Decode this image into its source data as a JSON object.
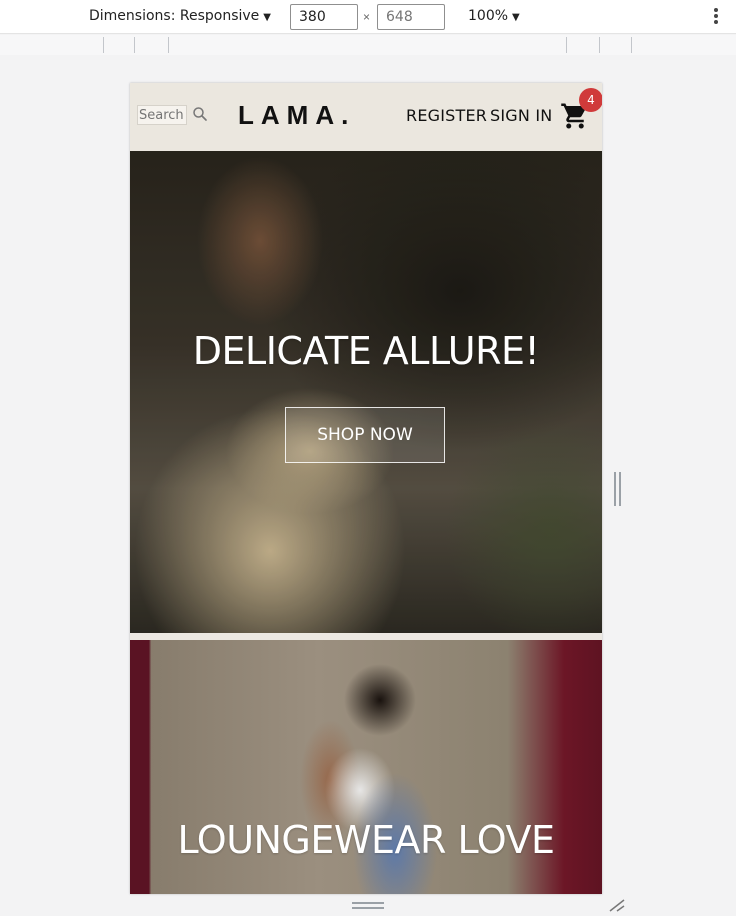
{
  "devtools": {
    "dimensions_label": "Dimensions: Responsive",
    "width_value": "380",
    "height_placeholder": "648",
    "times": "×",
    "zoom_label": "100%",
    "caret": "▼"
  },
  "site": {
    "search_placeholder": "Search",
    "logo": "LAMA.",
    "register": "REGISTER",
    "sign_in": "SIGN IN",
    "cart_count": "4",
    "badge_color": "#d03a3a",
    "navbar_bg": "#ebe7df"
  },
  "slides": [
    {
      "title": "DELICATE ALLURE!",
      "button": "SHOP NOW"
    },
    {
      "title": "LOUNGEWEAR LOVE"
    }
  ]
}
